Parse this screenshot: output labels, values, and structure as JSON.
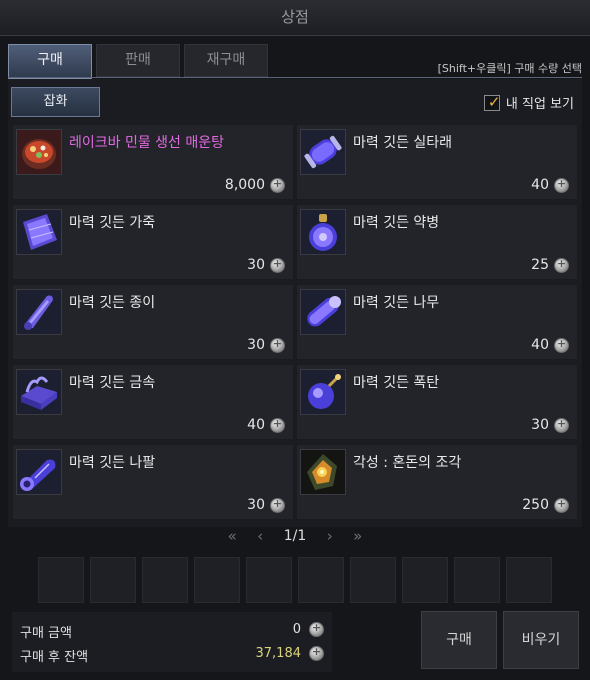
{
  "window": {
    "title": "상점"
  },
  "tabs": [
    {
      "label": "구매",
      "active": true
    },
    {
      "label": "판매",
      "active": false
    },
    {
      "label": "재구매",
      "active": false
    }
  ],
  "hint": "[Shift+우클릭] 구매 수량 선택",
  "category": {
    "label": "잡화"
  },
  "job_filter": {
    "label": "내 직업 보기",
    "checked": true
  },
  "items": [
    {
      "name": "레이크바 민물 생선 매운탕",
      "price": "8,000",
      "icon": "fish-stew-icon",
      "special": true
    },
    {
      "name": "마력 깃든 실타래",
      "price": "40",
      "icon": "thread-spool-icon"
    },
    {
      "name": "마력 깃든 가죽",
      "price": "30",
      "icon": "leather-icon"
    },
    {
      "name": "마력 깃든 약병",
      "price": "25",
      "icon": "potion-bottle-icon"
    },
    {
      "name": "마력 깃든 종이",
      "price": "30",
      "icon": "paper-scroll-icon"
    },
    {
      "name": "마력 깃든 나무",
      "price": "40",
      "icon": "wood-log-icon"
    },
    {
      "name": "마력 깃든 금속",
      "price": "40",
      "icon": "metal-ingot-icon"
    },
    {
      "name": "마력 깃든 폭탄",
      "price": "30",
      "icon": "bomb-icon"
    },
    {
      "name": "마력 깃든 나팔",
      "price": "30",
      "icon": "horn-icon"
    },
    {
      "name": "각성 : 혼돈의 조각",
      "price": "250",
      "icon": "chaos-shard-icon"
    }
  ],
  "pager": {
    "first": "«",
    "prev": "‹",
    "page": "1/1",
    "next": "›",
    "last": "»"
  },
  "summary": {
    "purchase_amount_label": "구매 금액",
    "purchase_amount": "0",
    "balance_label": "구매 후 잔액",
    "balance": "37,184"
  },
  "buttons": {
    "buy": "구매",
    "clear": "비우기"
  },
  "colors": {
    "special_item": "#e06adf",
    "balance": "#d9d47a",
    "check": "#f3b43a"
  }
}
